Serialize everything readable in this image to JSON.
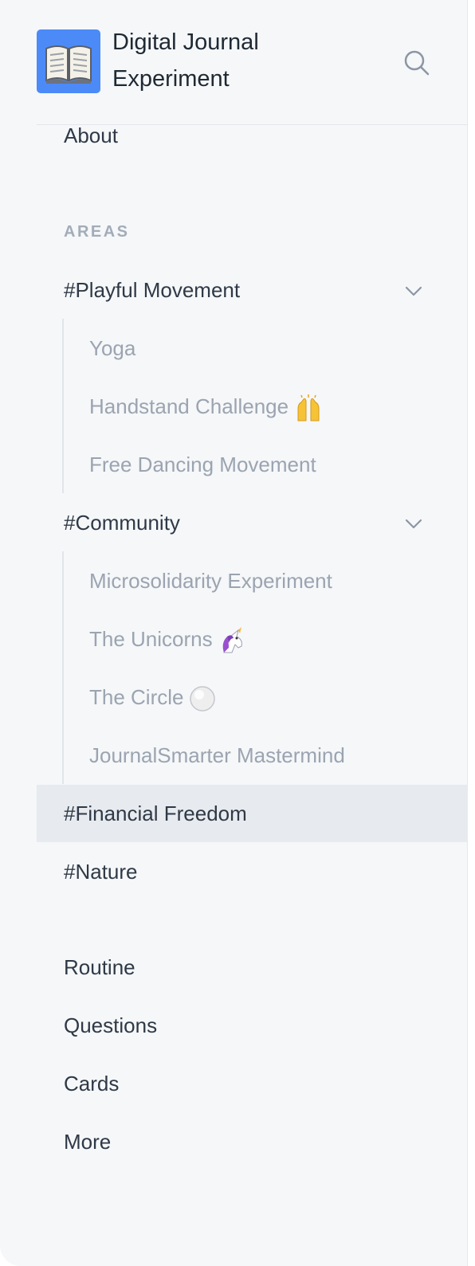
{
  "app": {
    "title": "Digital Journal Experiment",
    "logo_icon": "open-book-icon",
    "accent": "#4c8af8"
  },
  "nav_top": {
    "about": "About"
  },
  "areas": {
    "section_label": "AREAS",
    "groups": [
      {
        "label": "#Playful Movement",
        "expanded": true,
        "children": [
          {
            "label": "Yoga"
          },
          {
            "label": "Handstand Challenge",
            "emoji": "raising-hands-emoji"
          },
          {
            "label": "Free Dancing Movement"
          }
        ]
      },
      {
        "label": "#Community",
        "expanded": true,
        "children": [
          {
            "label": "Microsolidarity Experiment"
          },
          {
            "label": "The Unicorns",
            "emoji": "unicorn-emoji"
          },
          {
            "label": "The Circle",
            "emoji": "white-circle-emoji"
          },
          {
            "label": "JournalSmarter Mastermind"
          }
        ]
      },
      {
        "label": "#Financial Freedom",
        "active": true
      },
      {
        "label": "#Nature"
      }
    ]
  },
  "nav_bottom": {
    "routine": "Routine",
    "questions": "Questions",
    "cards": "Cards",
    "more": "More"
  }
}
